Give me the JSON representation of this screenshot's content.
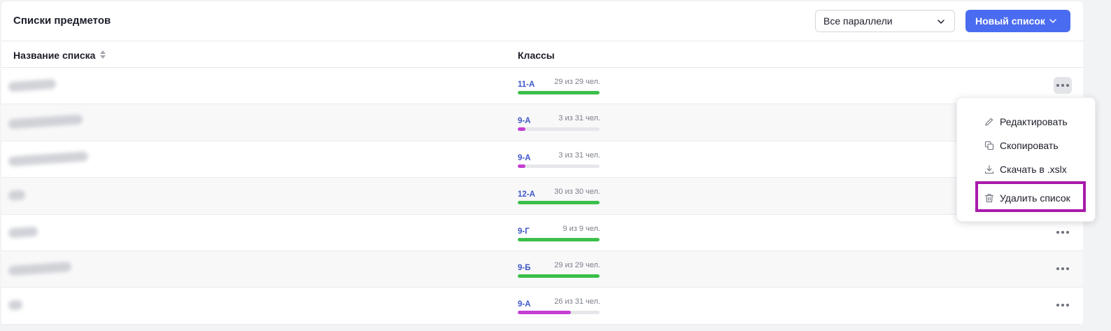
{
  "header": {
    "title": "Списки предметов",
    "filter_value": "Все параллели",
    "new_button_label": "Новый список",
    "accent_color": "#4a6cf0"
  },
  "table": {
    "columns": [
      "Название списка",
      "Классы"
    ],
    "rows": [
      {
        "class": "11-А",
        "count": "29 из 29 чел.",
        "progress": 1.0,
        "bar_color": "#3bbf4a",
        "menu_open": true
      },
      {
        "class": "9-А",
        "count": "3 из 31 чел.",
        "progress": 0.097,
        "bar_color": "#c53fd2",
        "menu_open": false
      },
      {
        "class": "9-А",
        "count": "3 из 31 чел.",
        "progress": 0.097,
        "bar_color": "#c53fd2",
        "menu_open": false
      },
      {
        "class": "12-А",
        "count": "30 из 30 чел.",
        "progress": 1.0,
        "bar_color": "#3bbf4a",
        "menu_open": false
      },
      {
        "class": "9-Г",
        "count": "9 из 9 чел.",
        "progress": 1.0,
        "bar_color": "#3bbf4a",
        "menu_open": false
      },
      {
        "class": "9-Б",
        "count": "29 из 29 чел.",
        "progress": 1.0,
        "bar_color": "#3bbf4a",
        "menu_open": false
      },
      {
        "class": "9-А",
        "count": "26 из 31 чел.",
        "progress": 0.65,
        "bar_color": "#c53fd2",
        "menu_open": false
      }
    ]
  },
  "context_menu": {
    "items": [
      {
        "label": "Редактировать",
        "icon": "pencil-icon"
      },
      {
        "label": "Скопировать",
        "icon": "copy-icon"
      },
      {
        "label": "Скачать в .xslx",
        "icon": "download-icon"
      },
      {
        "label": "Удалить список",
        "icon": "trash-icon"
      }
    ],
    "highlight_color": "#a81bab"
  }
}
